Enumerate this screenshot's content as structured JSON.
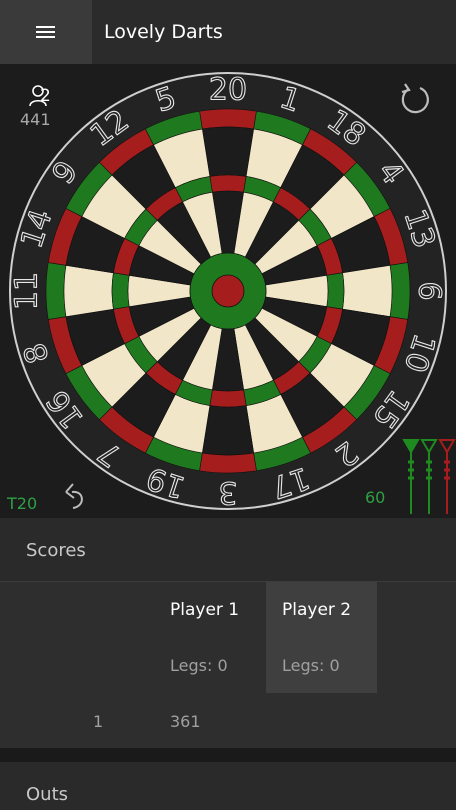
{
  "app": {
    "title": "Lovely Darts"
  },
  "board": {
    "numbers": [
      20,
      1,
      18,
      4,
      13,
      6,
      10,
      15,
      2,
      17,
      3,
      19,
      7,
      16,
      8,
      11,
      14,
      9,
      12,
      5
    ],
    "colors": {
      "red": "#a51d1d",
      "green": "#1f7a1f",
      "black": "#1c1c1c",
      "cream": "#f2e6c9",
      "wire": "#cfcfcf"
    }
  },
  "status": {
    "player_count": "2",
    "remaining": "441",
    "last_dart": "T20",
    "dart_score": "60"
  },
  "icons": {
    "menu": "hamburger-icon",
    "players": "person-icon",
    "reset": "refresh-icon",
    "undo": "undo-icon",
    "darts": "dart-icon"
  },
  "scores": {
    "header": "Scores",
    "players": [
      {
        "name": "Player 1",
        "legs": "Legs: 0",
        "active": false
      },
      {
        "name": "Player 2",
        "legs": "Legs: 0",
        "active": true
      }
    ],
    "rows": [
      {
        "round": "1",
        "score": "361"
      }
    ]
  },
  "outs": {
    "header": "Outs"
  },
  "theme": {
    "accent_green": "#2ea043",
    "active_column": "#3f3f3f"
  }
}
